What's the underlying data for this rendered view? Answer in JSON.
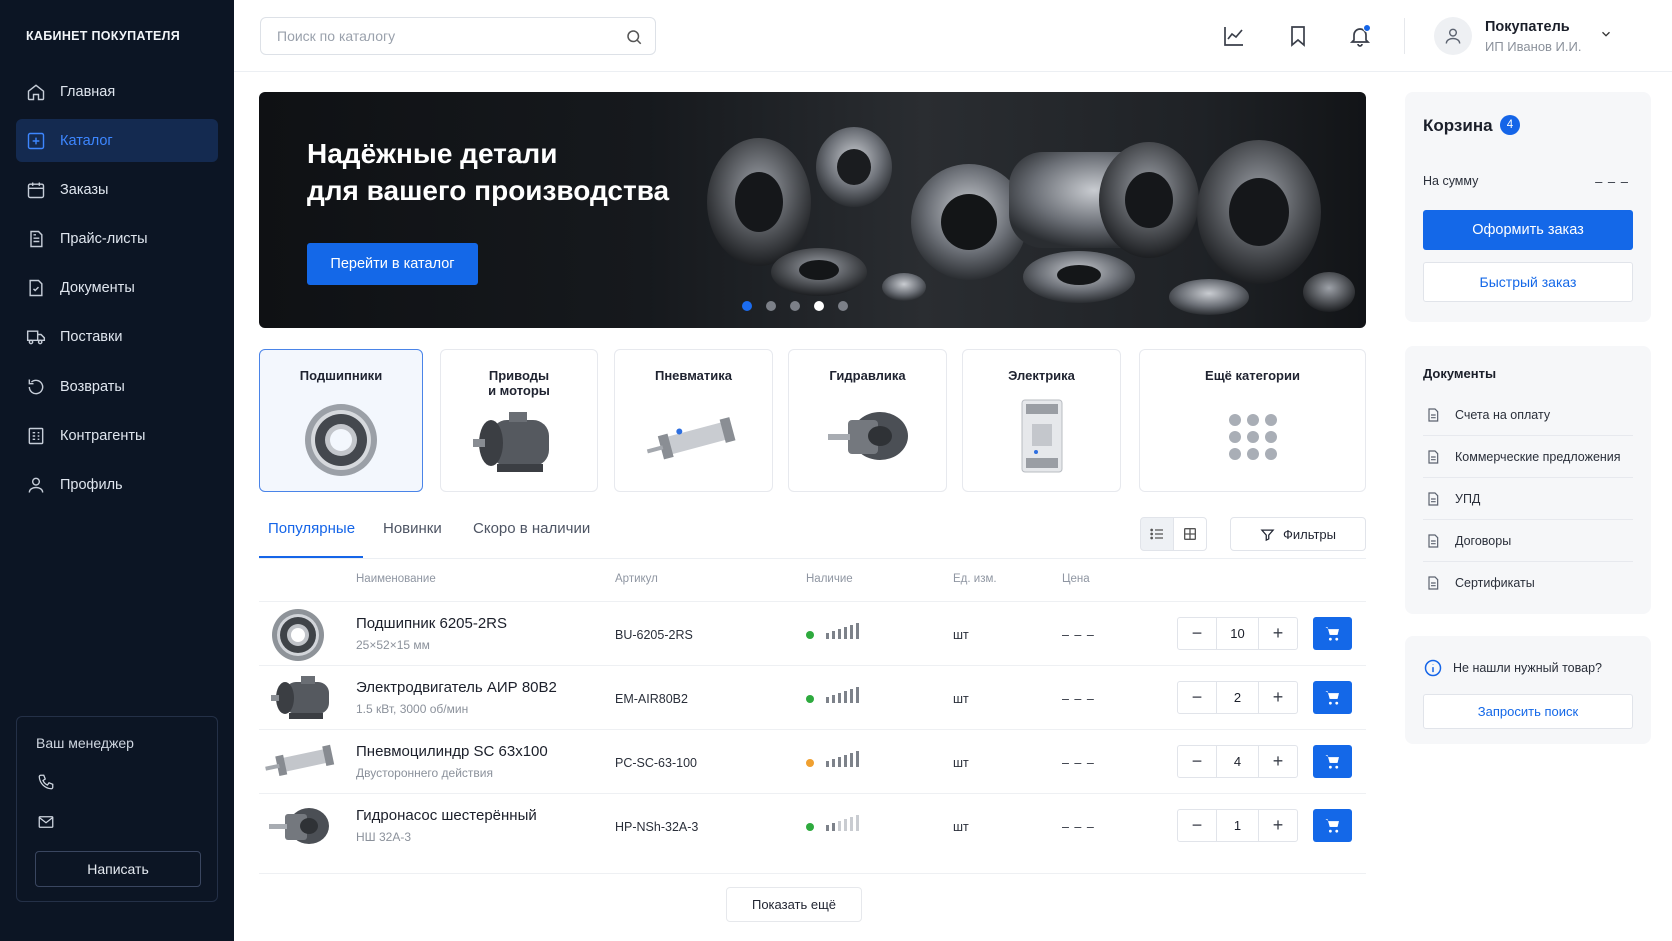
{
  "sidebar": {
    "brand": "КАБИНЕТ ПОКУПАТЕЛЯ",
    "items": [
      {
        "label": "Главная",
        "icon": "home-icon"
      },
      {
        "label": "Каталог",
        "icon": "catalog-icon",
        "active": true
      },
      {
        "label": "Заказы",
        "icon": "orders-icon"
      },
      {
        "label": "Прайс-листы",
        "icon": "price-list-icon"
      },
      {
        "label": "Документы",
        "icon": "documents-icon"
      },
      {
        "label": "Поставки",
        "icon": "truck-icon"
      },
      {
        "label": "Возвраты",
        "icon": "return-icon"
      },
      {
        "label": "Контрагенты",
        "icon": "counterparty-icon"
      },
      {
        "label": "Профиль",
        "icon": "user-icon"
      }
    ],
    "manager": {
      "title": "Ваш менеджер",
      "write_label": "Написать"
    }
  },
  "topbar": {
    "search_placeholder": "Поиск по каталогу",
    "user_name": "Покупатель",
    "user_company": "ИП Иванов И.И."
  },
  "hero": {
    "title": "Надёжные детали\nдля вашего производства",
    "cta": "Перейти в каталог",
    "slides": 5,
    "active_slide": 4
  },
  "categories": [
    {
      "label": "Подшипники",
      "selected": true
    },
    {
      "label": "Приводы\nи моторы"
    },
    {
      "label": "Пневматика"
    },
    {
      "label": "Гидравлика"
    },
    {
      "label": "Электрика"
    },
    {
      "label": "Ещё категории"
    }
  ],
  "tabs": [
    "Популярные",
    "Новинки",
    "Скоро в наличии"
  ],
  "active_tab": 0,
  "filters_label": "Фильтры",
  "table": {
    "headers": [
      "Наименование",
      "Артикул",
      "Наличие",
      "Ед. изм.",
      "Цена"
    ],
    "rows": [
      {
        "name": "Подшипник 6205-2RS",
        "desc": "25×52×15 мм",
        "sku": "BU-6205-2RS",
        "stock_color": "#2eaa3e",
        "unit": "шт",
        "price": "– – –",
        "qty": "10"
      },
      {
        "name": "Электродвигатель АИР 80В2",
        "desc": "1.5 кВт, 3000 об/мин",
        "sku": "EM-AIR80B2",
        "stock_color": "#2eaa3e",
        "unit": "шт",
        "price": "– – –",
        "qty": "2"
      },
      {
        "name": "Пневмоцилиндр SC 63x100",
        "desc": "Двустороннего действия",
        "sku": "PC-SC-63-100",
        "stock_color": "#f0a030",
        "unit": "шт",
        "price": "– – –",
        "qty": "4"
      },
      {
        "name": "Гидронасос шестерённый",
        "desc": "НШ 32А-3",
        "sku": "HP-NSh-32A-3",
        "stock_color": "#2eaa3e",
        "unit": "шт",
        "price": "– – –",
        "qty": "1"
      }
    ],
    "show_more": "Показать ещё"
  },
  "cart": {
    "title": "Корзина",
    "count": "4",
    "sum_label": "На сумму",
    "sum_value": "– – –",
    "order_label": "Оформить заказ",
    "quick_label": "Быстрый заказ"
  },
  "documents": {
    "title": "Документы",
    "items": [
      "Счета на оплату",
      "Коммерческие предложения",
      "УПД",
      "Договоры",
      "Сертификаты"
    ]
  },
  "not_found": {
    "text": "Не нашли нужный товар?",
    "button": "Запросить поиск"
  },
  "colors": {
    "accent": "#1468e8",
    "sidebar_bg": "#0c1524",
    "in_stock": "#2eaa3e",
    "low_stock": "#f0a030"
  }
}
